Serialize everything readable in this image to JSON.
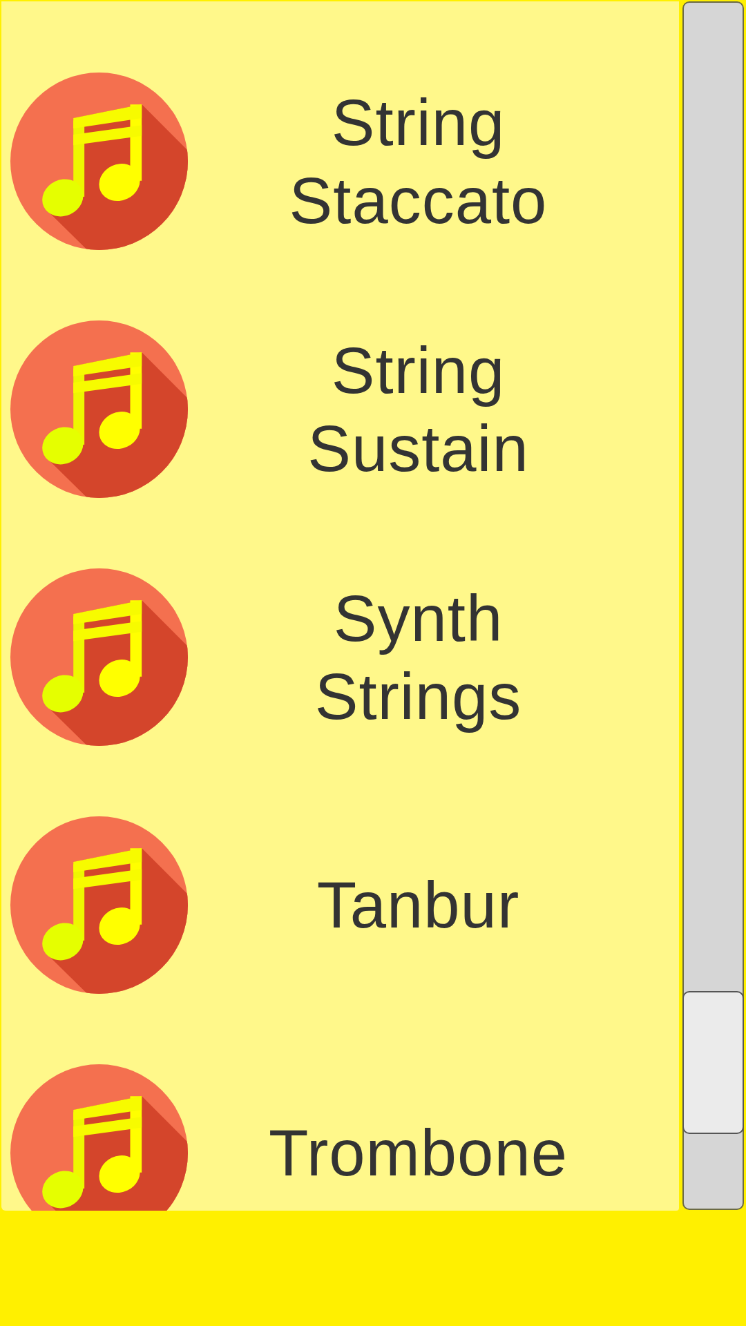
{
  "sound_list": {
    "items": [
      {
        "label": "String Staccato"
      },
      {
        "label": "String Sustain"
      },
      {
        "label": "Synth Strings"
      },
      {
        "label": "Tanbur"
      },
      {
        "label": "Trombone"
      }
    ]
  }
}
